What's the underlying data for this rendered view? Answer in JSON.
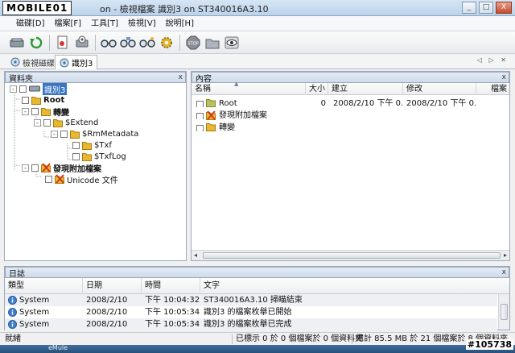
{
  "window": {
    "watermark": "MOBILE01",
    "title": "on - 檢視檔案 識別3 on ST340016A3.10",
    "controls": [
      "_",
      "□",
      "X"
    ]
  },
  "menu": [
    "磁碟[D]",
    "檔案[F]",
    "工具[T]",
    "檢視[V]",
    "說明[H]"
  ],
  "toolbar": {
    "buttons": [
      "drive-icon",
      "refresh-icon",
      "file-scan-icon",
      "disk-scan-icon",
      "glasses-icon",
      "glasses-options-icon",
      "glasses-search-icon",
      "gear-icon",
      "stop-icon",
      "folder-icon",
      "eye-icon"
    ]
  },
  "tabs": [
    {
      "label": "檢視磁碟",
      "active": false
    },
    {
      "label": "識別3",
      "active": true
    }
  ],
  "tab_nav": "◁ ▷ ✕",
  "folders_pane": {
    "title": "資料夾",
    "close": "x",
    "tree": [
      {
        "label": "識別3",
        "icon": "drive-icon",
        "selected": true,
        "expander": "-"
      },
      {
        "label": "Root",
        "icon": "folder-icon",
        "bold": true,
        "expander": ""
      },
      {
        "label": "轉變",
        "icon": "folder-icon",
        "bold": true,
        "expander": "-"
      },
      {
        "label": "$Extend",
        "icon": "folder-icon",
        "expander": "-"
      },
      {
        "label": "$RmMetadata",
        "icon": "folder-icon",
        "expander": "-"
      },
      {
        "label": "$Txf",
        "icon": "folder-icon",
        "expander": ""
      },
      {
        "label": "$TxfLog",
        "icon": "folder-icon",
        "expander": ""
      },
      {
        "label": "發現附加檔案",
        "icon": "found-files-icon",
        "bold": true,
        "expander": "-"
      },
      {
        "label": "Unicode 文件",
        "icon": "found-files-icon",
        "expander": ""
      }
    ]
  },
  "content_pane": {
    "title": "內容",
    "close": "x",
    "columns": [
      "名稱",
      "大小",
      "建立",
      "修改",
      "檔案"
    ],
    "rows": [
      {
        "name": "Root",
        "icon": "folder-icon",
        "size": "0",
        "created": "2008/2/10 下午 0...",
        "modified": "2008/2/10 下午 0...",
        "attr": ""
      },
      {
        "name": "發現附加檔案",
        "icon": "found-files-icon",
        "size": "",
        "created": "",
        "modified": "",
        "attr": ""
      },
      {
        "name": "轉變",
        "icon": "folder-icon",
        "size": "",
        "created": "",
        "modified": "",
        "attr": ""
      }
    ],
    "scroll_left": "◂",
    "scroll_right": "▸"
  },
  "log_pane": {
    "title": "日誌",
    "close": "x",
    "columns": [
      "類型",
      "日期",
      "時間",
      "文字"
    ],
    "rows": [
      {
        "type": "System",
        "date": "2008/2/10",
        "time": "下午 10:04:32",
        "text": "ST340016A3.10 掃瞄結束"
      },
      {
        "type": "System",
        "date": "2008/2/10",
        "time": "下午 10:05:34",
        "text": "識別3 的檔案枚舉已開始"
      },
      {
        "type": "System",
        "date": "2008/2/10",
        "time": "下午 10:05:34",
        "text": "識別3 的檔案枚舉已完成"
      }
    ]
  },
  "status": {
    "ready": "就緒",
    "selection": "已標示 0 於 0 個檔案於 0 個資料夾",
    "total": "總計 85.5 MB 於 21 個檔案於 8 個資料夾"
  },
  "taskbar_item": "eMule",
  "image_id": "#105738",
  "colors": {
    "selection": "#3a74c4",
    "pane_header": "#d7e2ef",
    "folder": "#e8b830",
    "found_files": "#d23a1a"
  }
}
